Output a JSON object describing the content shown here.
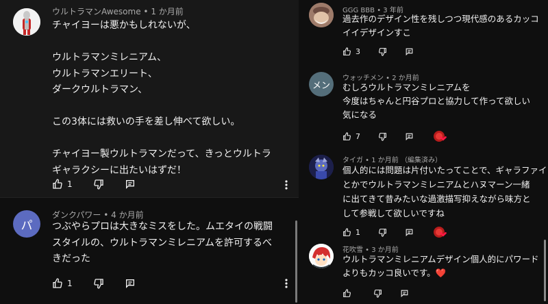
{
  "left_comments": [
    {
      "author": "ウルトラマンAwesome",
      "time": "1 か月前",
      "lines": [
        "チャイヨーは悪かもしれないが、",
        "",
        "ウルトラマンミレニアム、",
        "ウルトラマンエリート、",
        "ダークウルトラマン、",
        "",
        "この3体には救いの手を差し伸べて欲しい。",
        "",
        "チャイヨー製ウルトラマンだって、きっとウルトラ",
        "ギャラクシーに出たいはずだ！"
      ],
      "likes": "1"
    },
    {
      "author": "ダンクパワー",
      "time": "4 か月前",
      "avatar_letter": "パ",
      "lines": [
        "つぶやらプロは大きなミスをした。ムエタイの戦闘",
        "スタイルの、ウルトラマンミレニアムを許可するべ",
        "きだった"
      ],
      "likes": "1"
    }
  ],
  "right_comments": [
    {
      "author": "GGG BBB",
      "time": "3 年前",
      "lines": [
        "過去作のデザイン性を残しつつ現代感のあるカッコ",
        "イイデザインすこ"
      ],
      "likes": "3"
    },
    {
      "author": "ウォッチメン",
      "time": "2 か月前",
      "avatar_letter": "メン",
      "lines": [
        "むしろウルトラマンミレニアムを",
        "今度はちゃんと円谷プロと協力して作って欲しい",
        "気になる"
      ],
      "likes": "7"
    },
    {
      "author": "タイガ",
      "time": "1 か月前",
      "edited": "（編集済み）",
      "lines": [
        "個人的には問題は片付いたってことで、ギャラファイ",
        "とかでウルトラマンミレニアムとハヌマーン一緒",
        "に出てきて昔みたいな過激描写抑えながら味方と",
        "して参戦して欲しいですね"
      ],
      "likes": "1"
    },
    {
      "author": "花吹雪",
      "time": "3 か月前",
      "lines": [
        "ウルトラマンミレニアムデザイン個人的にパワード",
        "よりもカッコ良いです。❤️"
      ],
      "likes": ""
    }
  ],
  "sep": " • ",
  "colors": {
    "bg": "#0f0f0f",
    "highlight": "#181818",
    "meta": "#aaaaaa",
    "text": "#f1f1f1",
    "avatar_purple": "#5c6bc0",
    "avatar_slate": "#546e7a"
  }
}
